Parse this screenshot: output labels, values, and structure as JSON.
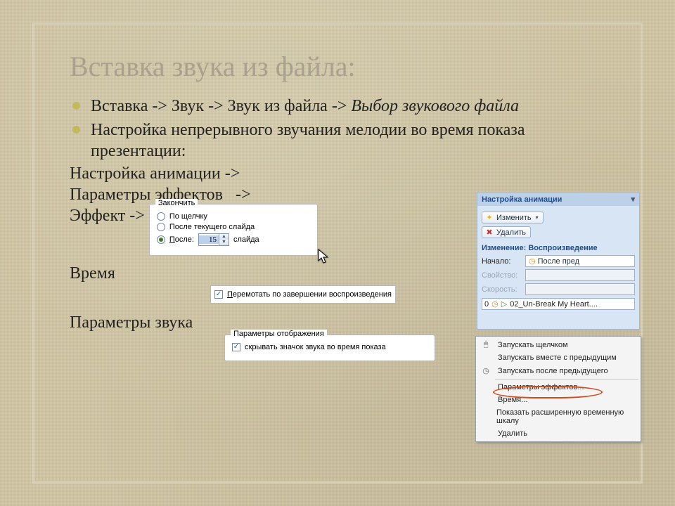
{
  "title": "Вставка звука из файла:",
  "bullets": [
    {
      "plain": "Вставка -> Звук -> Звук из файла -> ",
      "ital": "Выбор звукового файла"
    },
    {
      "plain": "Настройка непрерывного  звучания мелодии во время показа презентации:"
    }
  ],
  "steps": {
    "anim": "Настройка анимации ->",
    "params": "Параметры эффектов",
    "params_arrow": "->",
    "effect": "Эффект ->",
    "time": "Время",
    "sound": "Параметры звука"
  },
  "finish_group": {
    "legend": "Закончить",
    "opts": [
      "По щелчку",
      "После текущего слайда"
    ],
    "after_label": "После:",
    "after_value": "15",
    "after_unit": "слайда"
  },
  "rewind_check": "Перемотать по завершении воспроизведения",
  "display_group": {
    "legend": "Параметры отображения",
    "check": "скрывать значок звука во время показа"
  },
  "pane": {
    "title": "Настройка анимации",
    "change_btn": "Изменить",
    "delete_btn": "Удалить",
    "subheader": "Изменение: Воспроизведение",
    "rows": {
      "start_lbl": "Начало:",
      "start_val": "После пред",
      "prop_lbl": "Свойство:",
      "speed_lbl": "Скорость:"
    },
    "list_index": "0",
    "list_item": "02_Un-Break My Heart...."
  },
  "menu": {
    "items": [
      "Запускать щелчком",
      "Запускать вместе с предыдущим",
      "Запускать после предыдущего",
      "Параметры эффектов...",
      "Время...",
      "Показать расширенную временную шкалу",
      "Удалить"
    ]
  }
}
